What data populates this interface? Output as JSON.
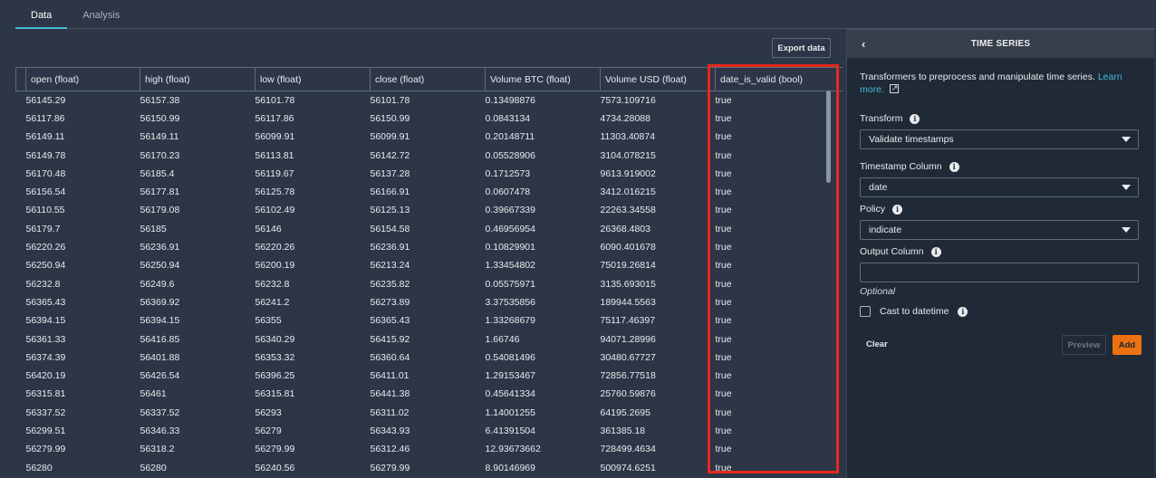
{
  "tabs": [
    {
      "label": "Data",
      "active": true
    },
    {
      "label": "Analysis",
      "active": false
    }
  ],
  "toolbar": {
    "export_label": "Export data"
  },
  "table": {
    "columns": [
      "open (float)",
      "high (float)",
      "low (float)",
      "close (float)",
      "Volume BTC (float)",
      "Volume USD (float)",
      "date_is_valid (bool)"
    ],
    "highlighted_column": "date_is_valid (bool)",
    "rows": [
      [
        "56145.29",
        "56157.38",
        "56101.78",
        "56101.78",
        "0.13498876",
        "7573.109716",
        "true"
      ],
      [
        "56117.86",
        "56150.99",
        "56117.86",
        "56150.99",
        "0.0843134",
        "4734.28088",
        "true"
      ],
      [
        "56149.11",
        "56149.11",
        "56099.91",
        "56099.91",
        "0.20148711",
        "11303.40874",
        "true"
      ],
      [
        "56149.78",
        "56170.23",
        "56113.81",
        "56142.72",
        "0.05528906",
        "3104.078215",
        "true"
      ],
      [
        "56170.48",
        "56185.4",
        "56119.67",
        "56137.28",
        "0.1712573",
        "9613.919002",
        "true"
      ],
      [
        "56156.54",
        "56177.81",
        "56125.78",
        "56166.91",
        "0.0607478",
        "3412.016215",
        "true"
      ],
      [
        "56110.55",
        "56179.08",
        "56102.49",
        "56125.13",
        "0.39667339",
        "22263.34558",
        "true"
      ],
      [
        "56179.7",
        "56185",
        "56146",
        "56154.58",
        "0.46956954",
        "26368.4803",
        "true"
      ],
      [
        "56220.26",
        "56236.91",
        "56220.26",
        "56236.91",
        "0.10829901",
        "6090.401678",
        "true"
      ],
      [
        "56250.94",
        "56250.94",
        "56200.19",
        "56213.24",
        "1.33454802",
        "75019.26814",
        "true"
      ],
      [
        "56232.8",
        "56249.6",
        "56232.8",
        "56235.82",
        "0.05575971",
        "3135.693015",
        "true"
      ],
      [
        "56365.43",
        "56369.92",
        "56241.2",
        "56273.89",
        "3.37535856",
        "189944.5563",
        "true"
      ],
      [
        "56394.15",
        "56394.15",
        "56355",
        "56365.43",
        "1.33268679",
        "75117.46397",
        "true"
      ],
      [
        "56361.33",
        "56416.85",
        "56340.29",
        "56415.92",
        "1.66746",
        "94071.28996",
        "true"
      ],
      [
        "56374.39",
        "56401.88",
        "56353.32",
        "56360.64",
        "0.54081496",
        "30480.67727",
        "true"
      ],
      [
        "56420.19",
        "56426.54",
        "56396.25",
        "56411.01",
        "1.29153467",
        "72856.77518",
        "true"
      ],
      [
        "56315.81",
        "56461",
        "56315.81",
        "56441.38",
        "0.45641334",
        "25760.59876",
        "true"
      ],
      [
        "56337.52",
        "56337.52",
        "56293",
        "56311.02",
        "1.14001255",
        "64195.2695",
        "true"
      ],
      [
        "56299.51",
        "56346.33",
        "56279",
        "56343.93",
        "6.41391504",
        "361385.18",
        "true"
      ],
      [
        "56279.99",
        "56318.2",
        "56279.99",
        "56312.46",
        "12.93673662",
        "728499.4634",
        "true"
      ],
      [
        "56280",
        "56280",
        "56240.56",
        "56279.99",
        "8.90146969",
        "500974.6251",
        "true"
      ]
    ]
  },
  "panel": {
    "back_icon": "chevron-left-icon",
    "title": "TIME SERIES",
    "description": "Transformers to preprocess and manipulate time series.",
    "learn_more": "Learn more.",
    "fields": {
      "transform": {
        "label": "Transform",
        "value": "Validate timestamps"
      },
      "timestamp_column": {
        "label": "Timestamp Column",
        "value": "date"
      },
      "policy": {
        "label": "Policy",
        "value": "indicate"
      },
      "output_column": {
        "label": "Output Column",
        "value": "",
        "hint": "Optional"
      },
      "cast_to_datetime": {
        "label": "Cast to datetime",
        "checked": false
      }
    },
    "buttons": {
      "clear": "Clear",
      "preview": "Preview",
      "add": "Add"
    }
  },
  "colors": {
    "accent": "#44b9d6",
    "primary_button": "#ec7211",
    "highlight_box": "#e8291c",
    "background": "#2c3647",
    "panel_background": "#202936"
  }
}
